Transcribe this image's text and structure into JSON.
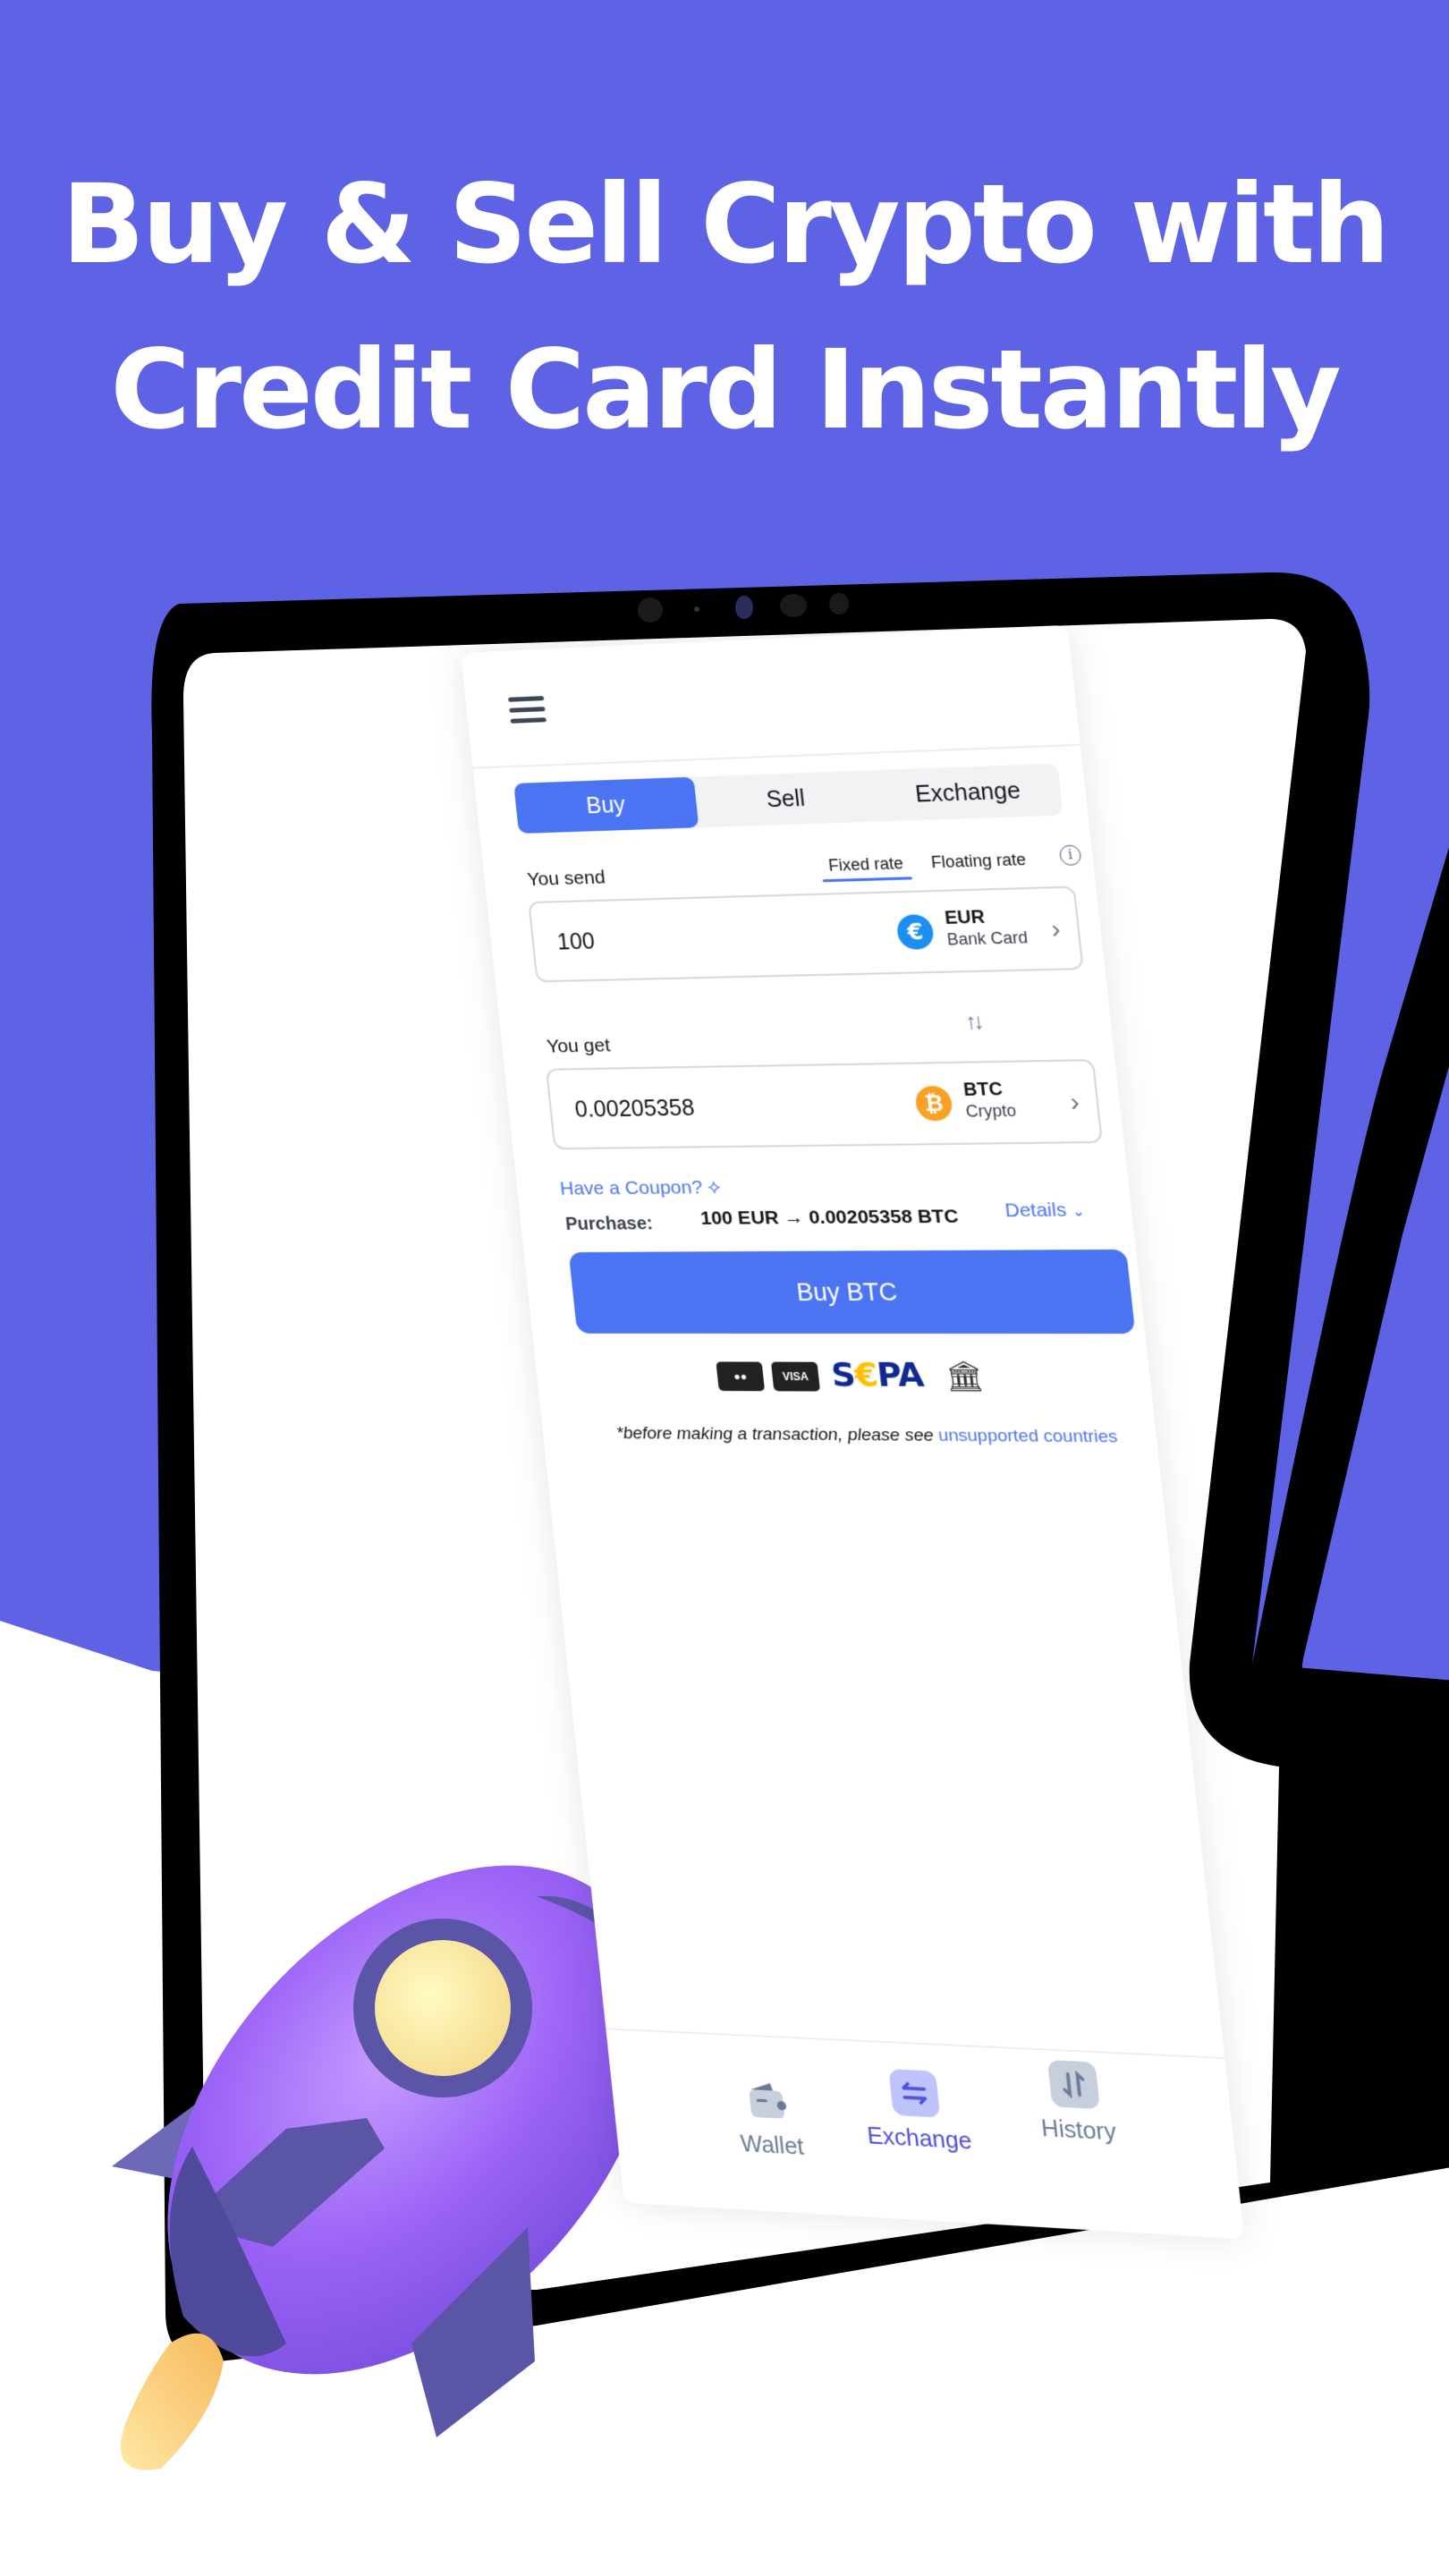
{
  "headline": {
    "line1": "Buy & Sell Crypto with",
    "line2": "Credit Card Instantly"
  },
  "colors": {
    "brand_background": "#5d63e4",
    "accent": "#4b74f3",
    "nav_active": "#4d4fd9",
    "rocket_body": "#8d5bf0",
    "rocket_fins": "#5b55a8",
    "rocket_flame": "#ffcd73"
  },
  "app": {
    "tabs": [
      {
        "label": "Buy",
        "active": true
      },
      {
        "label": "Sell",
        "active": false
      },
      {
        "label": "Exchange",
        "active": false
      }
    ],
    "send": {
      "label": "You send",
      "rate_options": [
        {
          "label": "Fixed rate",
          "active": true
        },
        {
          "label": "Floating rate",
          "active": false
        }
      ],
      "info_icon": "info-icon",
      "amount": "100",
      "currency_code": "EUR",
      "currency_type": "Bank Card",
      "currency_icon": "€"
    },
    "swap_icon": "↑↓",
    "get": {
      "label": "You get",
      "amount": "0.00205358",
      "currency_code": "BTC",
      "currency_type": "Crypto",
      "currency_icon": "₿"
    },
    "coupon_link": "Have a Coupon?",
    "purchase": {
      "label": "Purchase:",
      "value": "100 EUR → 0.00205358 BTC"
    },
    "details_link": "Details",
    "buy_button": "Buy BTC",
    "payment_methods": {
      "mastercard": "●●",
      "visa": "VISA",
      "sepa_s": "S",
      "sepa_euro": "€",
      "sepa_pa": "PA",
      "bank_icon": "🏛"
    },
    "disclaimer": {
      "text": "*before making a transaction, please see ",
      "link": "unsupported countries"
    },
    "bottom_nav": [
      {
        "label": "Wallet",
        "icon": "wallet-icon",
        "active": false
      },
      {
        "label": "Exchange",
        "icon": "exchange-icon",
        "active": true
      },
      {
        "label": "History",
        "icon": "history-icon",
        "active": false
      }
    ]
  }
}
